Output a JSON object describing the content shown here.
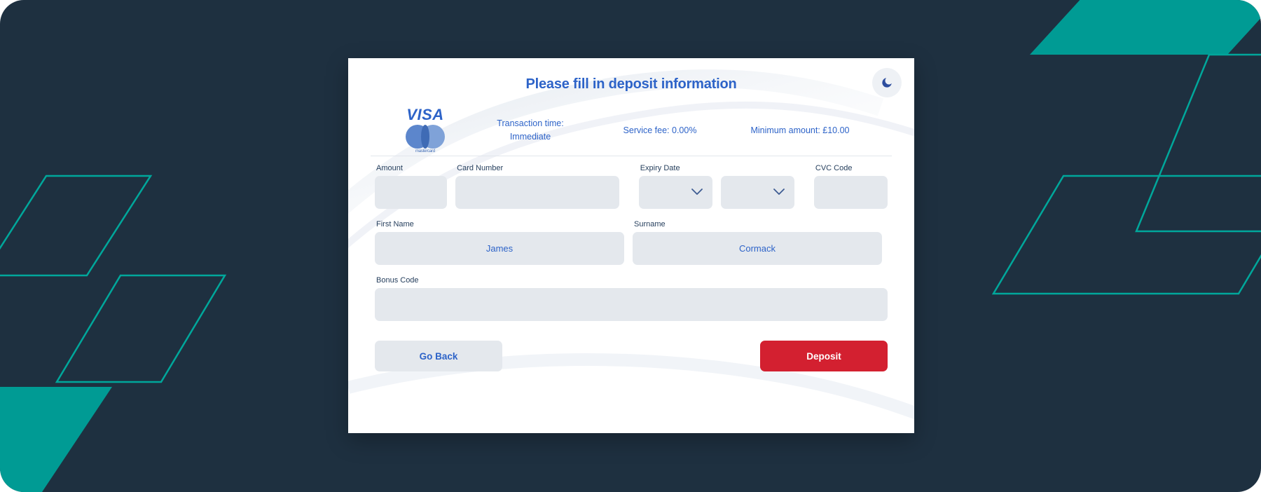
{
  "theme": {
    "background_color": "#1E3040",
    "accent_teal": "#009B94",
    "brand_blue": "#2D63C8",
    "deposit_red": "#D32030",
    "field_fill": "#E4E8ED",
    "label_color": "#27405E"
  },
  "panel": {
    "title": "Please fill in deposit information",
    "darkmode_icon": "moon-icon"
  },
  "payment_methods": {
    "visa_label": "VISA",
    "mastercard_label": "mastercard"
  },
  "info": {
    "transaction_time_label": "Transaction time:",
    "transaction_time_value": "Immediate",
    "service_fee": "Service fee: 0.00%",
    "minimum_amount": "Minimum amount: £10.00"
  },
  "form": {
    "fields": [
      {
        "name": "amount",
        "label": "Amount",
        "value": "",
        "placeholder": "",
        "type": "text"
      },
      {
        "name": "card_number",
        "label": "Card Number",
        "value": "",
        "placeholder": "",
        "type": "text"
      },
      {
        "name": "expiry_month",
        "label": "Expiry Date",
        "value": "",
        "placeholder": "",
        "type": "select"
      },
      {
        "name": "expiry_year",
        "label": "",
        "value": "",
        "placeholder": "",
        "type": "select"
      },
      {
        "name": "cvc_code",
        "label": "CVC Code",
        "value": "",
        "placeholder": "",
        "type": "text"
      },
      {
        "name": "first_name",
        "label": "First Name",
        "value": "James",
        "placeholder": "",
        "type": "text"
      },
      {
        "name": "surname",
        "label": "Surname",
        "value": "Cormack",
        "placeholder": "",
        "type": "text"
      },
      {
        "name": "bonus_code",
        "label": "Bonus Code",
        "value": "",
        "placeholder": "",
        "type": "text"
      }
    ]
  },
  "actions": {
    "go_back": "Go Back",
    "deposit": "Deposit"
  }
}
